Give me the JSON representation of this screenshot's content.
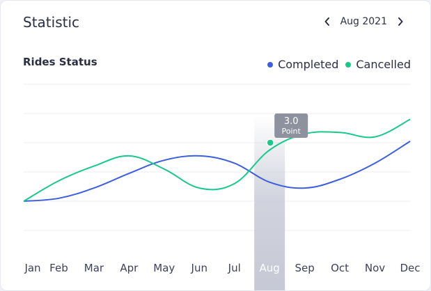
{
  "header": {
    "title": "Statistic",
    "month_label": "Aug 2021",
    "prev_icon": "chevron-left-icon",
    "next_icon": "chevron-right-icon"
  },
  "chart_data": {
    "type": "line",
    "title": "Rides Status",
    "categories": [
      "Jan",
      "Feb",
      "Mar",
      "Apr",
      "May",
      "Jun",
      "Jul",
      "Aug",
      "Sep",
      "Oct",
      "Nov",
      "Dec"
    ],
    "series": [
      {
        "name": "Completed",
        "color": "#3b5fe0",
        "values": [
          1.0,
          1.1,
          1.45,
          1.95,
          2.4,
          2.55,
          2.3,
          1.65,
          1.45,
          1.75,
          2.3,
          3.05
        ]
      },
      {
        "name": "Cancelled",
        "color": "#19c98a",
        "values": [
          1.0,
          1.7,
          2.2,
          2.55,
          2.1,
          1.45,
          1.6,
          2.75,
          3.3,
          3.35,
          3.2,
          3.8
        ]
      }
    ],
    "highlight": {
      "category": "Aug",
      "series": "Cancelled",
      "point_value": 3.0,
      "value_label": "3.0",
      "unit_label": "Point"
    },
    "ylim": [
      0,
      5
    ],
    "grid": true,
    "legend_position": "top-right"
  }
}
